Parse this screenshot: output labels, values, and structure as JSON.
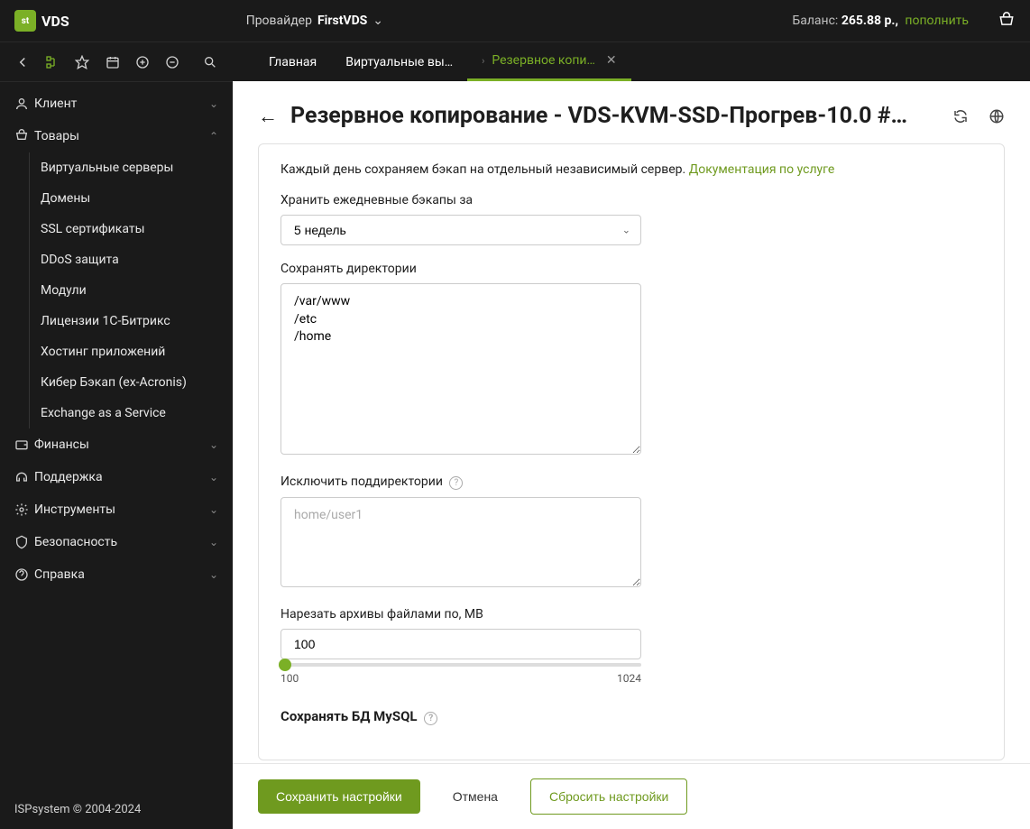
{
  "header": {
    "logo_text": "VDS",
    "provider_prefix": "Провайдер",
    "provider_name": "FirstVDS",
    "balance_label": "Баланс:",
    "balance_value": "265.88 р.,",
    "topup_label": "пополнить"
  },
  "tabs": {
    "main": "Главная",
    "vms": "Виртуальные вы…",
    "backup": "Резервное копи…"
  },
  "sidebar": {
    "client": "Клиент",
    "goods": "Товары",
    "goods_items": [
      "Виртуальные серверы",
      "Домены",
      "SSL сертификаты",
      "DDoS защита",
      "Модули",
      "Лицензии 1С-Битрикс",
      "Хостинг приложений",
      "Кибер Бэкап (ex-Acronis)",
      "Exchange as a Service"
    ],
    "finance": "Финансы",
    "support": "Поддержка",
    "tools": "Инструменты",
    "security": "Безопасность",
    "help": "Справка",
    "footer": "ISPsystem © 2004-2024"
  },
  "page": {
    "title": "Резервное копирование - VDS-KVM-SSD-Прогрев-10.0 #…",
    "intro_text": "Каждый день сохраняем бэкап на отдельный независимый сервер.",
    "doc_link": "Документация по услуге",
    "retention_label": "Хранить ежедневные бэкапы за",
    "retention_value": "5 недель",
    "dirs_label": "Сохранять директории",
    "dirs_value": "/var/www\n/etc\n/home",
    "exclude_label": "Исключить поддиректории",
    "exclude_placeholder": "home/user1",
    "split_label": "Нарезать архивы файлами по, МВ",
    "split_value": "100",
    "split_min": "100",
    "split_max": "1024",
    "mysql_label": "Сохранять БД MySQL"
  },
  "buttons": {
    "save": "Сохранить настройки",
    "cancel": "Отмена",
    "reset": "Сбросить настройки"
  }
}
